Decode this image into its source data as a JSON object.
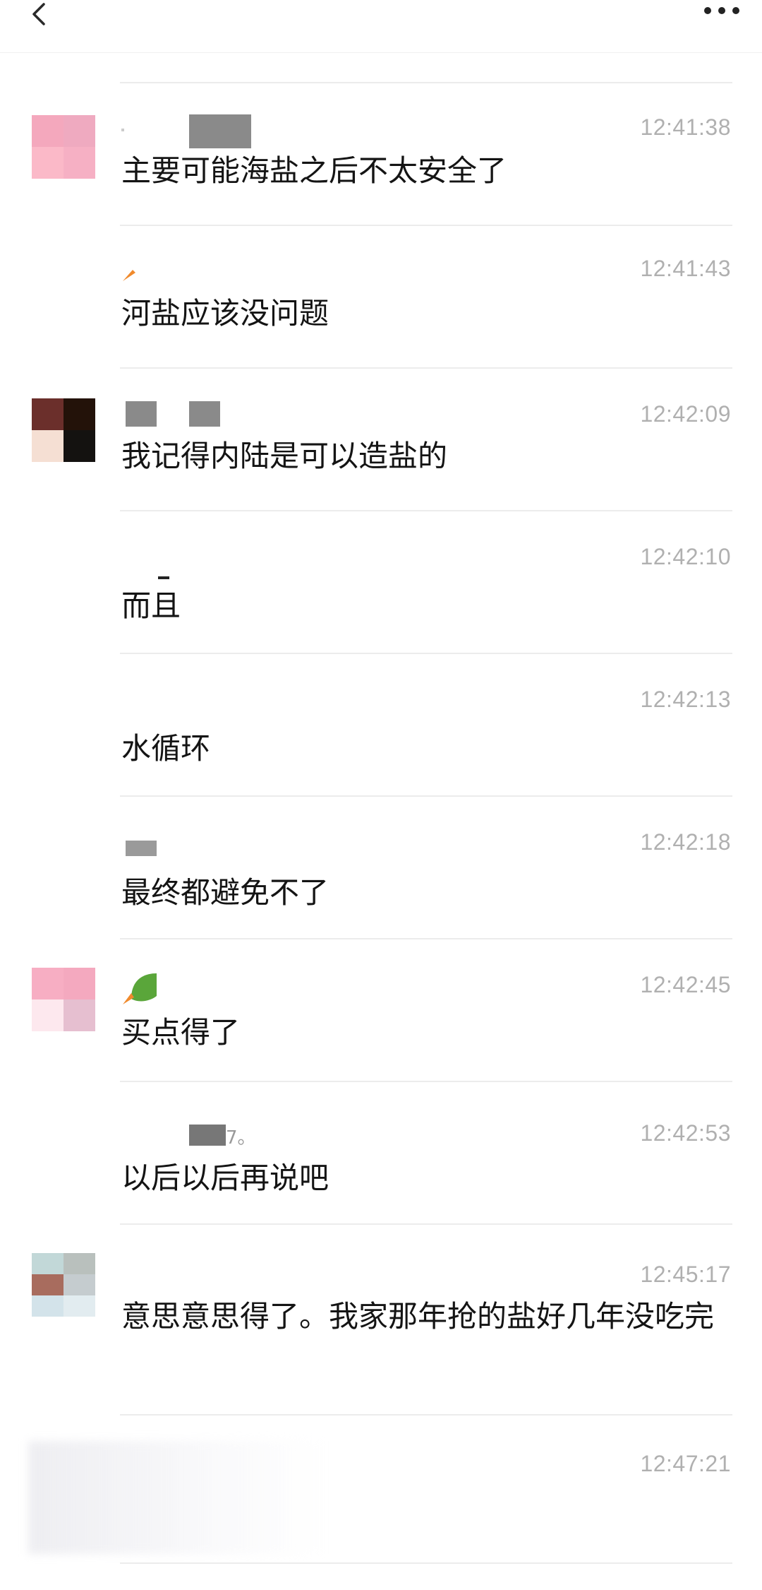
{
  "header": {
    "back_icon": "chevron-left-icon",
    "more_icon": "more-dots-icon"
  },
  "messages": [
    {
      "time": "12:41:38",
      "text": "主要可能海盐之后不太安全了",
      "avatar_colors": [
        "#f4a8bd",
        "#efaac0",
        "#fbb9c8",
        "#f6b0c4"
      ]
    },
    {
      "time": "12:41:43",
      "text": "河盐应该没问题"
    },
    {
      "time": "12:42:09",
      "text": "我记得内陆是可以造盐的",
      "avatar_colors": [
        "#6b2f2b",
        "#231209",
        "#f5dfd3",
        "#141210"
      ]
    },
    {
      "time": "12:42:10",
      "text": "而且"
    },
    {
      "time": "12:42:13",
      "text": "水循环"
    },
    {
      "time": "12:42:18",
      "text": "最终都避免不了"
    },
    {
      "time": "12:42:45",
      "text": "买点得了",
      "avatar_colors": [
        "#f7aec3",
        "#f4a9bf",
        "#fde8ee",
        "#e6bfd0"
      ]
    },
    {
      "time": "12:42:53",
      "text": "以后以后再说吧",
      "sender_fragment": "7。"
    },
    {
      "time": "12:45:17",
      "text": "意思意思得了。我家那年抢的盐好几年没吃完",
      "avatar_colors": [
        "#c2d8d8",
        "#b9c0bd",
        "#a86c5e",
        "#c5cccf",
        "#d3e3ea",
        "#e2ecf0"
      ]
    },
    {
      "time": "12:47:21",
      "text": ""
    }
  ]
}
